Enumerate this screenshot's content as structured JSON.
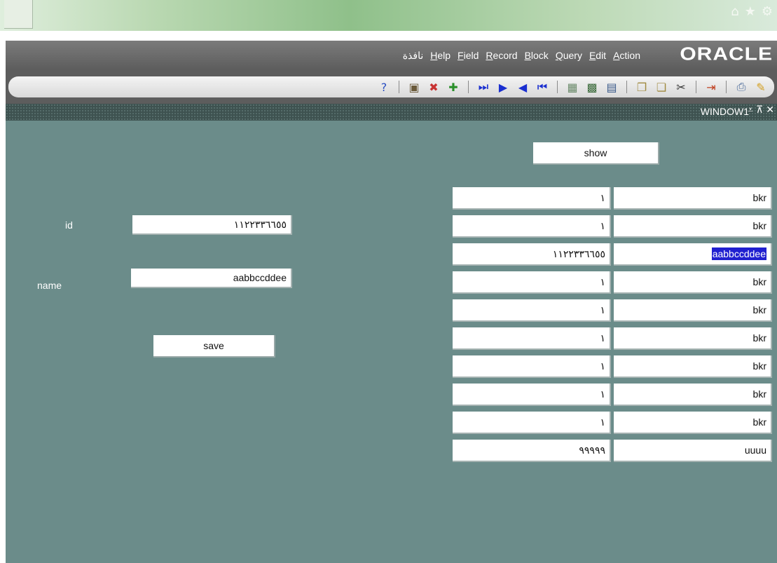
{
  "browser": {
    "tools": [
      {
        "icon": "home-icon",
        "glyph": "⌂"
      },
      {
        "icon": "star-icon",
        "glyph": "★"
      },
      {
        "icon": "gear-icon",
        "glyph": "⚙"
      }
    ]
  },
  "menubar": {
    "items": [
      "نافذة",
      "Help",
      "Field",
      "Record",
      "Block",
      "Query",
      "Edit",
      "Action"
    ],
    "logo": "ORACLE"
  },
  "toolbar": {
    "icons": [
      {
        "icon": "help-icon",
        "glyph": "?",
        "color": "#2b4fc2"
      },
      {
        "sep": true
      },
      {
        "icon": "save-icon",
        "glyph": "▣",
        "color": "#6a5a3a"
      },
      {
        "icon": "clear-icon",
        "glyph": "✖",
        "color": "#c83232"
      },
      {
        "icon": "insert-record-icon",
        "glyph": "✚",
        "color": "#2a8f2a"
      },
      {
        "sep": true
      },
      {
        "icon": "last-record-icon",
        "glyph": "⏭",
        "color": "#1a2fd0"
      },
      {
        "icon": "next-record-icon",
        "glyph": "▶",
        "color": "#1a2fd0"
      },
      {
        "icon": "prev-record-icon",
        "glyph": "◀",
        "color": "#1a2fd0"
      },
      {
        "icon": "first-record-icon",
        "glyph": "⏮",
        "color": "#1a2fd0"
      },
      {
        "sep": true
      },
      {
        "icon": "enter-query-icon",
        "glyph": "▦",
        "color": "#6a8a6a"
      },
      {
        "icon": "execute-query-icon",
        "glyph": "▩",
        "color": "#3a6a3a"
      },
      {
        "icon": "cancel-query-icon",
        "glyph": "▤",
        "color": "#3a5a8a"
      },
      {
        "sep": true
      },
      {
        "icon": "copy-icon",
        "glyph": "❐",
        "color": "#a08a40"
      },
      {
        "icon": "paste-icon",
        "glyph": "❏",
        "color": "#a08a40"
      },
      {
        "icon": "cut-icon",
        "glyph": "✂",
        "color": "#333333"
      },
      {
        "sep": true
      },
      {
        "icon": "exit-icon",
        "glyph": "⇥",
        "color": "#c04020"
      },
      {
        "sep": true
      },
      {
        "icon": "print-icon",
        "glyph": "⎙",
        "color": "#4a6a9a"
      },
      {
        "icon": "edit-icon",
        "glyph": "✎",
        "color": "#d4a020"
      }
    ]
  },
  "window": {
    "title": "WINDOW1",
    "controls": [
      {
        "icon": "minimize-icon",
        "glyph": "⩡"
      },
      {
        "icon": "maximize-icon",
        "glyph": "⊼"
      },
      {
        "icon": "close-icon",
        "glyph": "✕"
      }
    ]
  },
  "form": {
    "id_label": "id",
    "id_value": "١١٢٢٣٣٦٦٥٥",
    "name_label": "name",
    "name_value": "aabbccddee",
    "save_label": "save",
    "show_label": "show"
  },
  "records": [
    {
      "id": "١",
      "name": "bkr"
    },
    {
      "id": "١",
      "name": "bkr"
    },
    {
      "id": "١١٢٢٣٣٦٦٥٥",
      "name": "aabbccddee",
      "selected": true
    },
    {
      "id": "١",
      "name": "bkr"
    },
    {
      "id": "١",
      "name": "bkr"
    },
    {
      "id": "١",
      "name": "bkr"
    },
    {
      "id": "١",
      "name": "bkr"
    },
    {
      "id": "١",
      "name": "bkr"
    },
    {
      "id": "١",
      "name": "bkr"
    },
    {
      "id": "٩٩٩٩٩",
      "name": "uuuu"
    }
  ],
  "colors": {
    "canvas": "#6b8c8a",
    "selection": "#2020d0"
  }
}
